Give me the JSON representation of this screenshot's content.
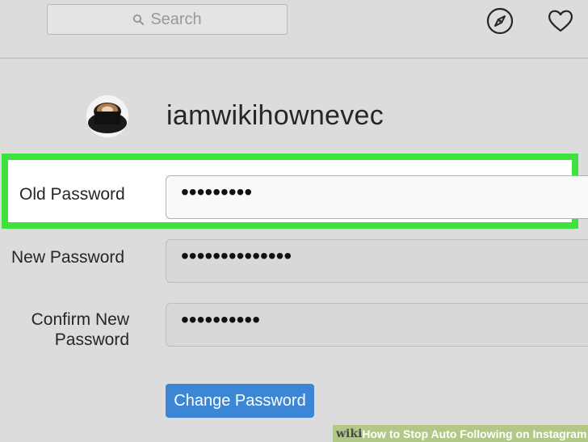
{
  "header": {
    "search_placeholder": "Search",
    "icons": [
      "search-icon",
      "compass-icon",
      "heart-icon"
    ]
  },
  "profile": {
    "username": "iamwikihownevec"
  },
  "form": {
    "old_password_label": "Old Password",
    "old_password_value": "•••••••••",
    "new_password_label": "New Password",
    "new_password_value": "••••••••••••••",
    "confirm_label_line1": "Confirm New",
    "confirm_label_line2": "Password",
    "confirm_password_value": "••••••••••",
    "submit_label": "Change Password"
  },
  "watermark": {
    "brand": "wiki",
    "how": "How",
    "title": "to Stop Auto Following on Instagram"
  },
  "colors": {
    "highlight": "#3ee23e",
    "button": "#3b87d6",
    "background": "#dcdcdc"
  }
}
